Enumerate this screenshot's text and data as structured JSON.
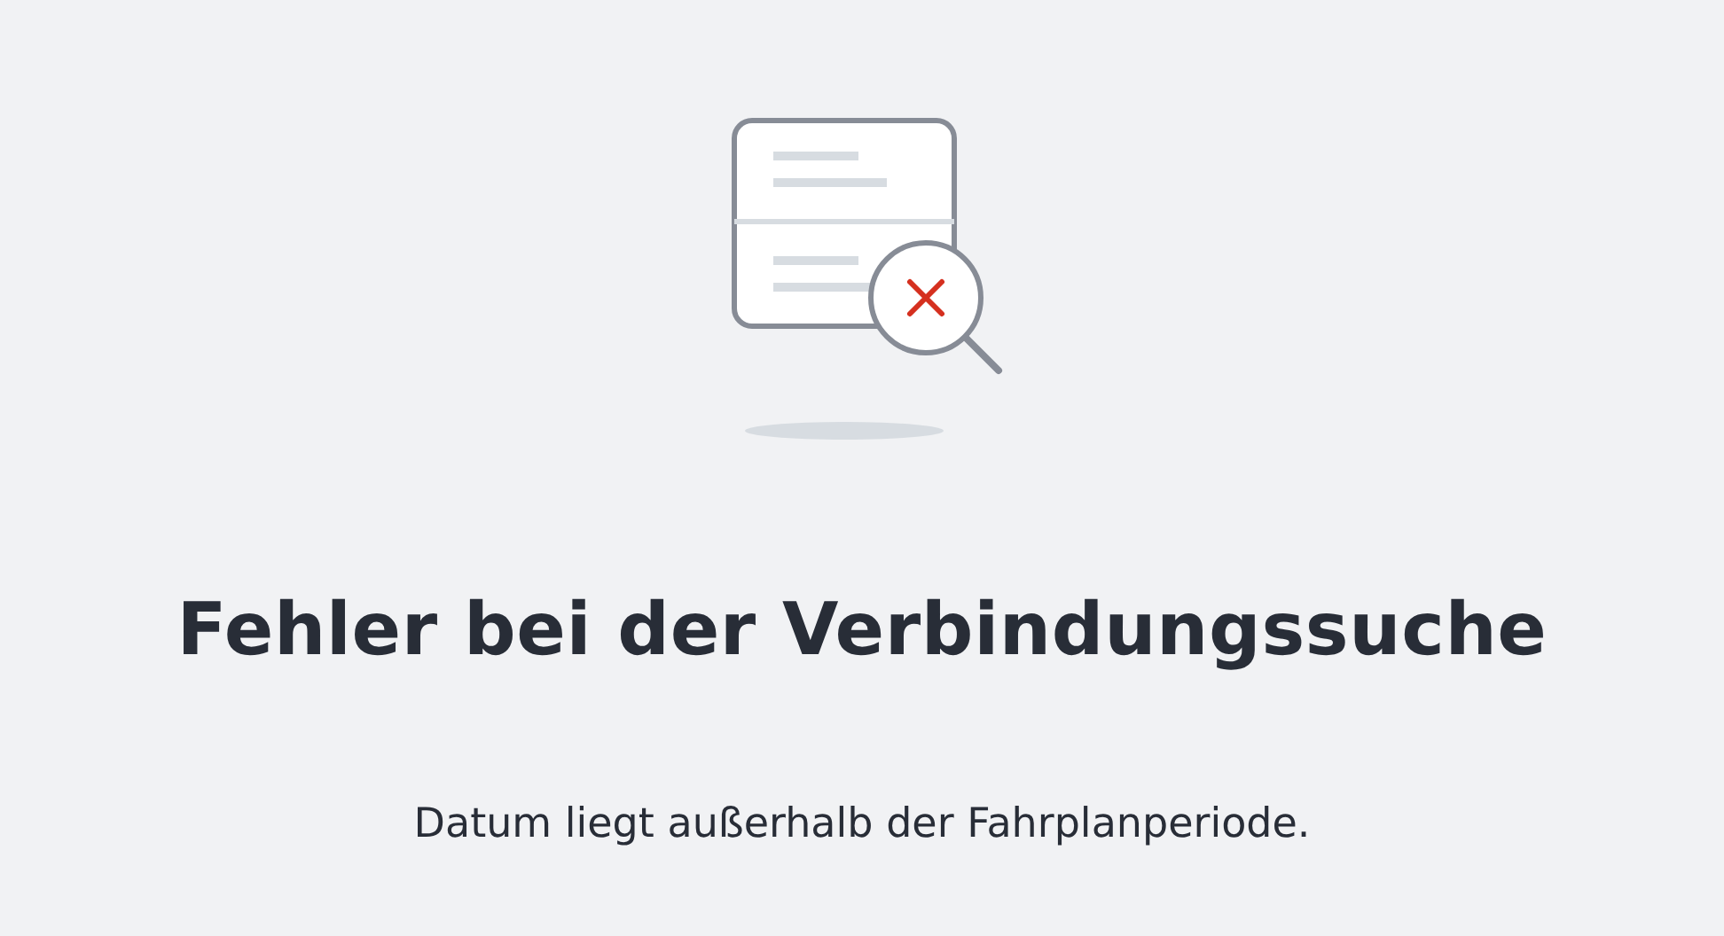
{
  "error": {
    "title": "Fehler bei der Verbindungssuche",
    "message": "Datum liegt außerhalb der Fahrplanperiode."
  }
}
